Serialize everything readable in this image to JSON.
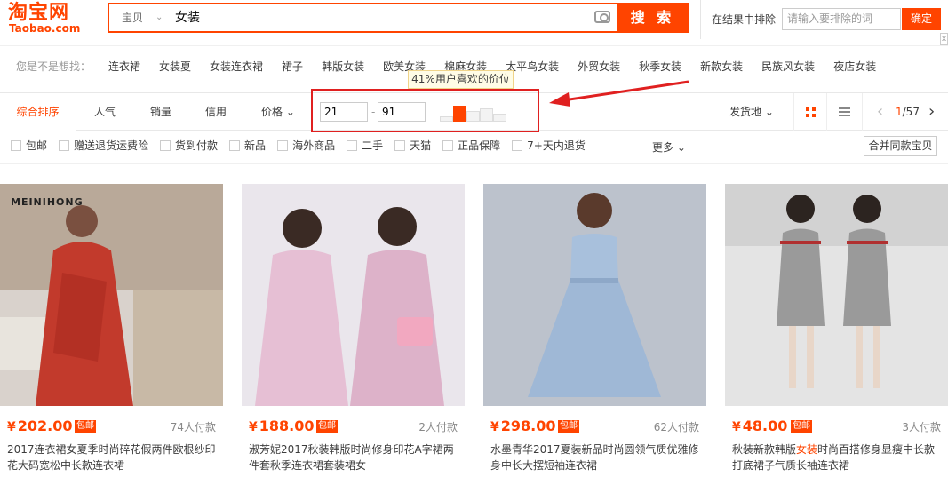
{
  "header": {
    "logo_cn": "淘宝网",
    "logo_en": "Taobao.com",
    "search_category": "宝贝",
    "search_query": "女装",
    "search_button": "搜 索",
    "exclude_label": "在结果中排除",
    "exclude_placeholder": "请输入要排除的词",
    "confirm_button": "确定",
    "close": "x"
  },
  "suggest": {
    "label": "您是不是想找：",
    "items": [
      "连衣裙",
      "女装夏",
      "女装连衣裙",
      "裙子",
      "韩版女装",
      "欧美女装",
      "棉麻女装",
      "太平鸟女装",
      "外贸女装",
      "秋季女装",
      "新款女装",
      "民族风女装",
      "夜店女装"
    ]
  },
  "sort": {
    "tabs": [
      "综合排序",
      "人气",
      "销量",
      "信用",
      "价格 ⌄"
    ],
    "price_from": "21",
    "price_to": "91",
    "dash": "-",
    "tooltip": "41%用户喜欢的价位",
    "histogram": [
      0.25,
      0.8,
      0.55,
      0.7,
      0.4
    ],
    "histogram_selected": 1,
    "ship_from": "发货地 ⌄",
    "pager_current": "1",
    "pager_total": "/57",
    "prev": "‹",
    "next": "›"
  },
  "filters": {
    "items": [
      "包邮",
      "赠送退货运费险",
      "货到付款",
      "新品",
      "海外商品",
      "二手",
      "天猫",
      "正品保障",
      "7+天内退货"
    ],
    "more": "更多 ⌄",
    "merge_button": "合并同款宝贝"
  },
  "items": [
    {
      "price": "202.00",
      "yen": "¥",
      "badge": "包邮",
      "sold": "74人付款",
      "title": "2017连衣裙女夏季时尚碎花假两件欧根纱印花大码宽松中长款连衣裙",
      "brand": "MEINIHONG"
    },
    {
      "price": "188.00",
      "yen": "¥",
      "badge": "包邮",
      "sold": "2人付款",
      "title": "淑芳妮2017秋装韩版时尚修身印花A字裙两件套秋季连衣裙套装裙女"
    },
    {
      "price": "298.00",
      "yen": "¥",
      "badge": "包邮",
      "sold": "62人付款",
      "title": "水墨青华2017夏装新品时尚圆领气质优雅修身中长大摆短袖连衣裙"
    },
    {
      "price": "48.00",
      "yen": "¥",
      "badge": "包邮",
      "sold": "3人付款",
      "title_pre": "秋装新款韩版",
      "title_hl": "女装",
      "title_post": "时尚百搭修身显瘦中长款打底裙子气质长袖连衣裙"
    }
  ],
  "colors": {
    "accent": "#ff4400",
    "highlight_box": "#e02020",
    "arrow": "#e02020"
  }
}
